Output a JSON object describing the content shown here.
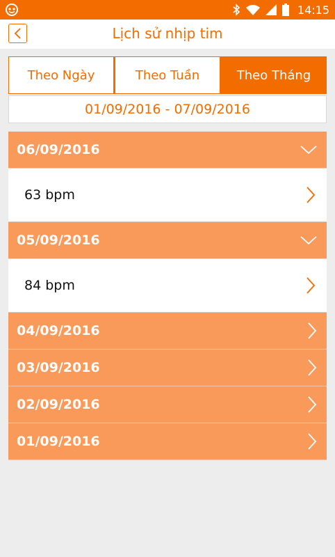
{
  "status_bar": {
    "time": "14:15",
    "icons": [
      "app-notification-icon",
      "bluetooth-icon",
      "wifi-icon",
      "signal-icon",
      "battery-icon"
    ]
  },
  "header": {
    "title": "Lịch sử nhịp tim",
    "back_icon": "chevron-left-icon"
  },
  "tabs": [
    {
      "label": "Theo Ngày",
      "active": false
    },
    {
      "label": "Theo Tuần",
      "active": false
    },
    {
      "label": "Theo Tháng",
      "active": true
    }
  ],
  "date_range": "01/09/2016 - 07/09/2016",
  "days": [
    {
      "date": "06/09/2016",
      "expanded": true,
      "value": "63 bpm"
    },
    {
      "date": "05/09/2016",
      "expanded": true,
      "value": "84 bpm"
    },
    {
      "date": "04/09/2016",
      "expanded": false
    },
    {
      "date": "03/09/2016",
      "expanded": false
    },
    {
      "date": "02/09/2016",
      "expanded": false
    },
    {
      "date": "01/09/2016",
      "expanded": false
    }
  ],
  "colors": {
    "accent": "#f26c00",
    "date_row_bg": "#f99a5a",
    "page_bg": "#ededed"
  }
}
